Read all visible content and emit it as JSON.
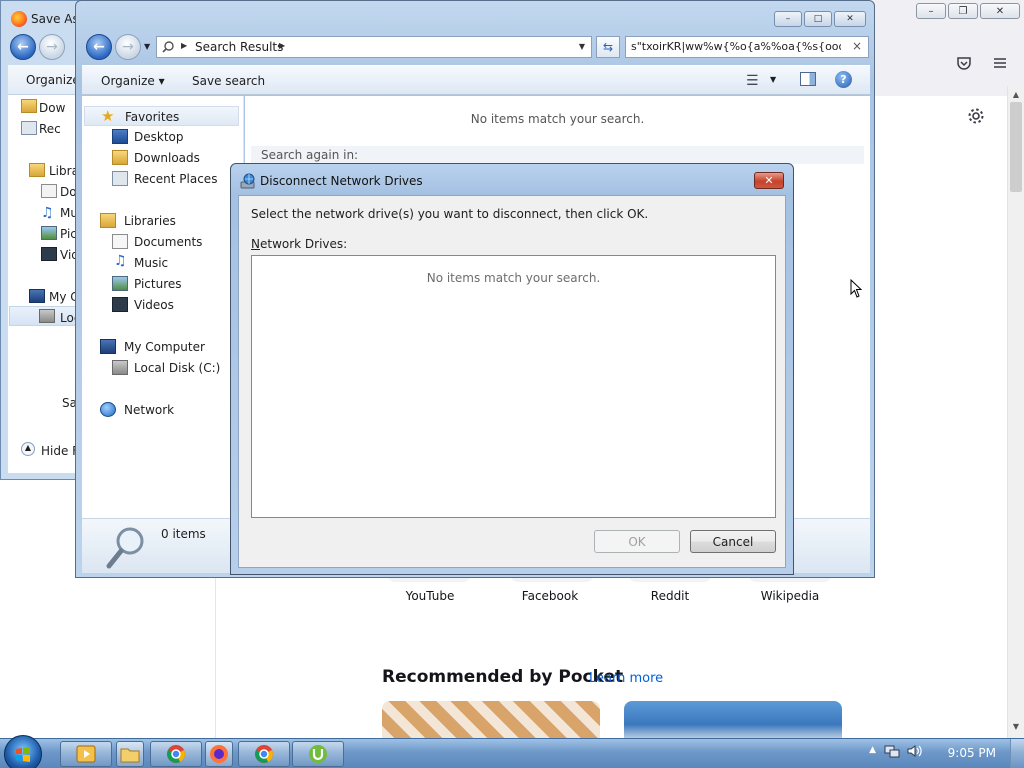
{
  "firefox": {
    "tiles": [
      {
        "label": "YouTube"
      },
      {
        "label": "Facebook"
      },
      {
        "label": "Reddit"
      },
      {
        "label": "Wikipedia"
      }
    ],
    "pocket": {
      "title": "Recommended by Pocket",
      "link": "Learn more"
    }
  },
  "back_dialog": {
    "title": "Save As",
    "organize_label": "Organize",
    "tree": [
      {
        "label": "Dow",
        "icon": "downloads-folder-icon"
      },
      {
        "label": "Rec",
        "icon": "recent-places-icon"
      },
      {
        "label": "Libra",
        "icon": "libraries-icon"
      },
      {
        "label": "Doc",
        "icon": "documents-icon"
      },
      {
        "label": "Mu",
        "icon": "music-icon"
      },
      {
        "label": "Pic",
        "icon": "pictures-icon"
      },
      {
        "label": "Vid",
        "icon": "videos-icon"
      },
      {
        "label": "My C",
        "icon": "computer-icon"
      },
      {
        "label": "Loc",
        "icon": "local-disk-icon"
      }
    ],
    "save_label": "Sav",
    "hide_folders_label": "Hide F"
  },
  "explorer": {
    "breadcrumb": "Search Results",
    "search_query": "s\"txoirKR|ww%w{%o{a%%oa{%s{oooa<",
    "organize_label": "Organize",
    "save_search_label": "Save search",
    "nav_tree": [
      {
        "label": "Favorites",
        "icon": "favorites-star-icon"
      },
      {
        "label": "Desktop",
        "icon": "desktop-icon"
      },
      {
        "label": "Downloads",
        "icon": "downloads-folder-icon"
      },
      {
        "label": "Recent Places",
        "icon": "recent-places-icon"
      },
      {
        "label": "Libraries",
        "icon": "libraries-icon"
      },
      {
        "label": "Documents",
        "icon": "documents-icon"
      },
      {
        "label": "Music",
        "icon": "music-icon"
      },
      {
        "label": "Pictures",
        "icon": "pictures-icon"
      },
      {
        "label": "Videos",
        "icon": "videos-icon"
      },
      {
        "label": "My Computer",
        "icon": "computer-icon"
      },
      {
        "label": "Local Disk (C:)",
        "icon": "local-disk-icon"
      },
      {
        "label": "Network",
        "icon": "network-icon"
      }
    ],
    "empty_message": "No items match your search.",
    "search_again_label": "Search again in:",
    "item_count": "0 items"
  },
  "disconnect_dialog": {
    "title": "Disconnect Network Drives",
    "instruction": "Select the network drive(s) you want to disconnect, then click OK.",
    "list_label_accesskey": "N",
    "list_label_rest": "etwork Drives:",
    "empty_message": "No items match your search.",
    "ok_label": "OK",
    "cancel_label": "Cancel"
  },
  "taskbar": {
    "clock": "9:05 PM"
  }
}
